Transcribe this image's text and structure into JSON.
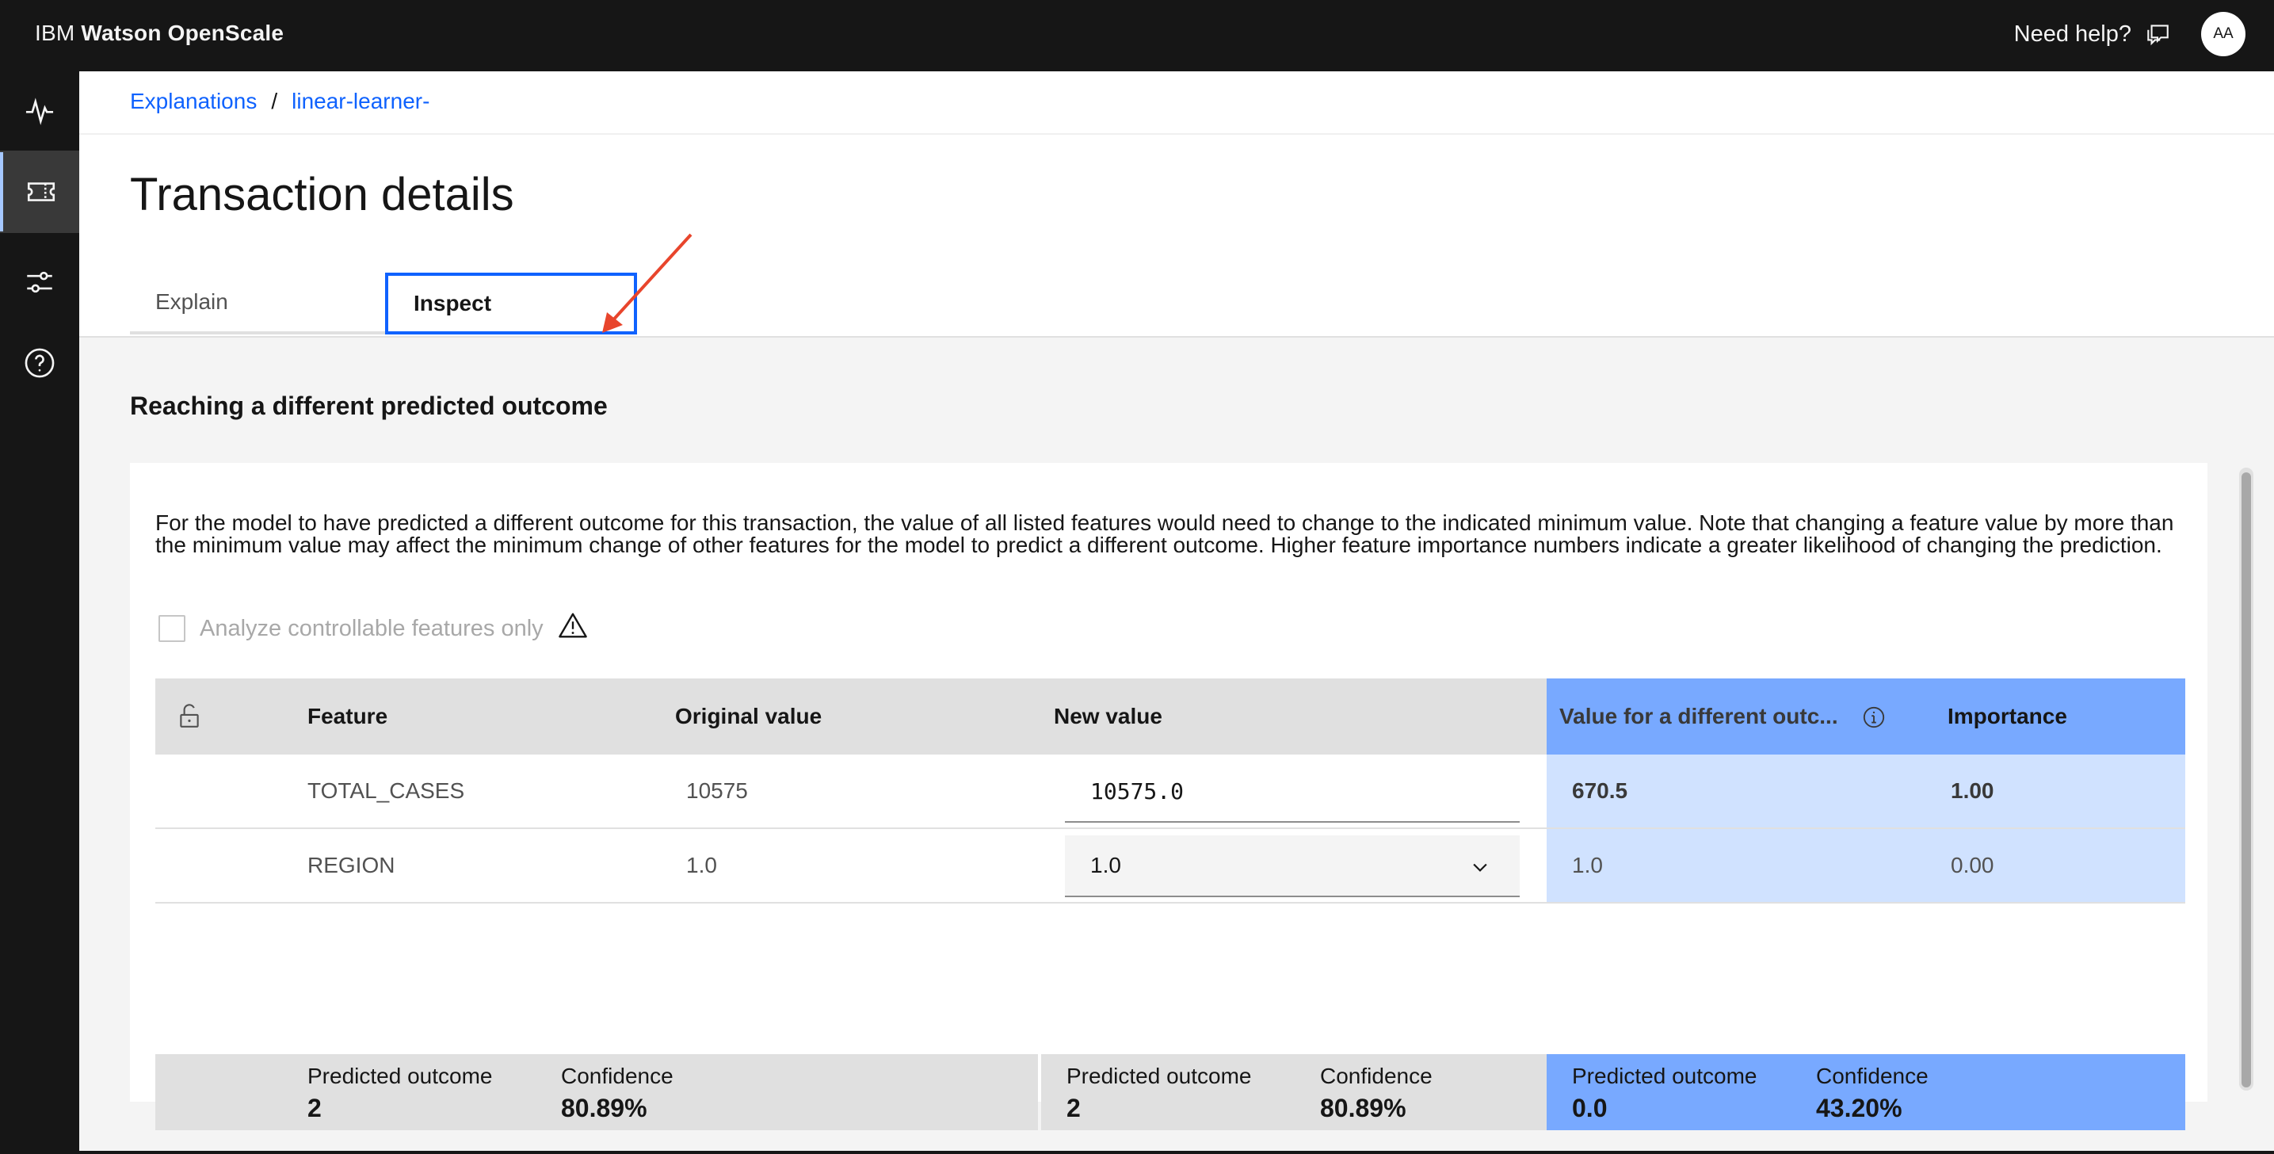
{
  "topbar": {
    "brand_light": "IBM ",
    "brand_bold": "Watson OpenScale",
    "help_label": "Need help?",
    "avatar_initials": "AA"
  },
  "sidebar": {
    "items": [
      {
        "icon": "activity-icon"
      },
      {
        "icon": "ticket-icon",
        "active": true
      },
      {
        "icon": "sliders-icon"
      },
      {
        "icon": "help-icon"
      }
    ]
  },
  "breadcrumb": {
    "items": [
      "Explanations",
      "linear-learner-"
    ],
    "separator": "/"
  },
  "page_title": "Transaction details",
  "tabs": [
    {
      "label": "Explain",
      "selected": false
    },
    {
      "label": "Inspect",
      "selected": true
    }
  ],
  "section_title": "Reaching a different predicted outcome",
  "description": "For the model to have predicted a different outcome for this transaction, the value of all listed features would need to change to the indicated minimum value. Note that changing a feature value by more than the minimum value may affect the minimum change of other features for the model to predict a different outcome. Higher feature importance numbers indicate a greater likelihood of changing the prediction.",
  "checkbox": {
    "label": "Analyze controllable features only",
    "checked": false
  },
  "table": {
    "headers": {
      "feature": "Feature",
      "original": "Original value",
      "new_value": "New value",
      "different": "Value for a different outc...",
      "importance": "Importance"
    },
    "rows": [
      {
        "feature": "TOTAL_CASES",
        "original": "10575",
        "new_value": "10575.0",
        "different": "670.5",
        "importance": "1.00"
      },
      {
        "feature": "REGION",
        "original": "1.0",
        "new_value": "1.0",
        "different": "1.0",
        "importance": "0.00"
      }
    ]
  },
  "summary": [
    {
      "outcome_label": "Predicted outcome",
      "outcome": "2",
      "confidence_label": "Confidence",
      "confidence": "80.89%"
    },
    {
      "outcome_label": "Predicted outcome",
      "outcome": "2",
      "confidence_label": "Confidence",
      "confidence": "80.89%"
    },
    {
      "outcome_label": "Predicted outcome",
      "outcome": "0.0",
      "confidence_label": "Confidence",
      "confidence": "43.20%"
    }
  ],
  "colors": {
    "accent": "#0f62fe",
    "highlight_header": "#78a9ff",
    "highlight_cell": "#d0e2ff",
    "annotation_arrow": "#e8452c"
  }
}
